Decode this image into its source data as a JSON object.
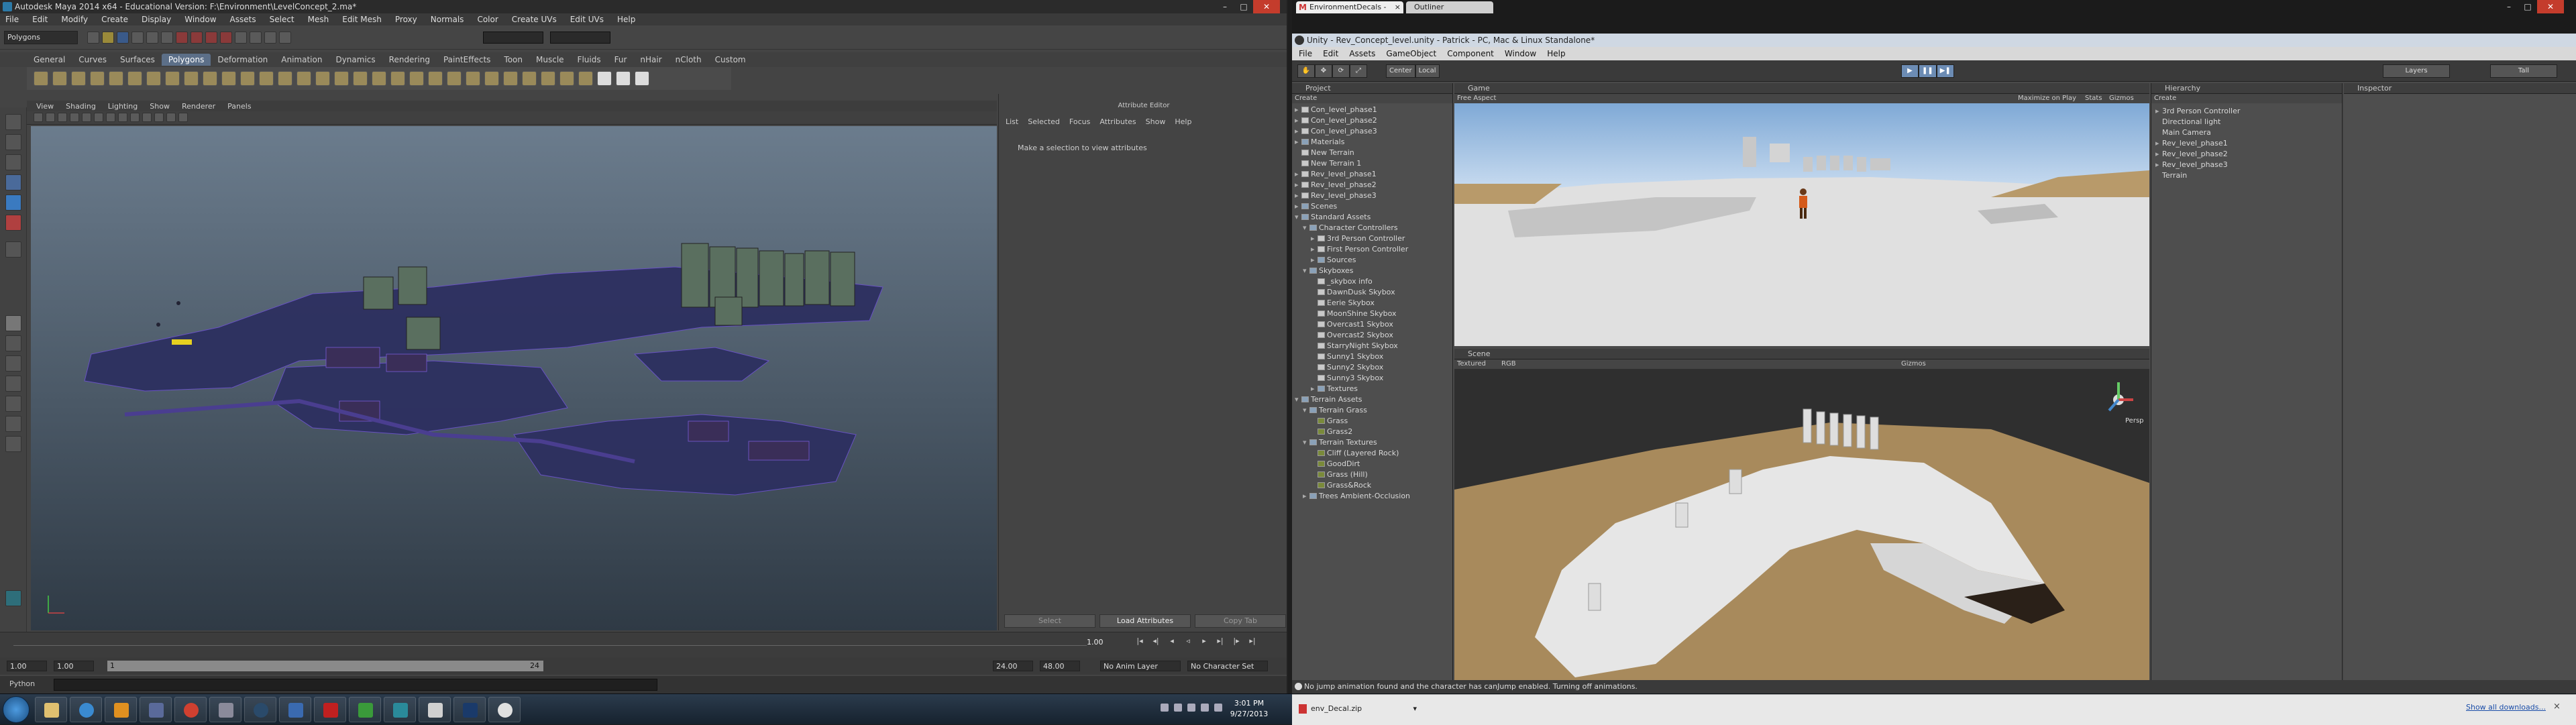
{
  "maya": {
    "title": "Autodesk Maya 2014 x64 - Educational Version: F:\\Environment\\LevelConcept_2.ma*",
    "menus": [
      "File",
      "Edit",
      "Modify",
      "Create",
      "Display",
      "Window",
      "Assets",
      "Select",
      "Mesh",
      "Edit Mesh",
      "Proxy",
      "Normals",
      "Color",
      "Create UVs",
      "Edit UVs",
      "Help"
    ],
    "mode": "Polygons",
    "shelf_tabs": [
      "General",
      "Curves",
      "Surfaces",
      "Polygons",
      "Deformation",
      "Animation",
      "Dynamics",
      "Rendering",
      "PaintEffects",
      "Toon",
      "Muscle",
      "Fluids",
      "Fur",
      "nHair",
      "nCloth",
      "Custom"
    ],
    "active_shelf_tab": "Polygons",
    "panel_menus": [
      "View",
      "Shading",
      "Lighting",
      "Show",
      "Renderer",
      "Panels"
    ],
    "attribute_editor": {
      "header": "Attribute Editor",
      "menus": [
        "List",
        "Selected",
        "Focus",
        "Attributes",
        "Show",
        "Help"
      ],
      "message": "Make a selection to view attributes",
      "buttons": [
        "Select",
        "Load Attributes",
        "Copy Tab"
      ]
    },
    "time": {
      "current_frame": "1.00",
      "start": "1.00",
      "start2": "1.00",
      "range_start": "1",
      "range_end": "24",
      "end": "24.00",
      "end2": "48.00",
      "anim_layer": "No Anim Layer",
      "char_set": "No Character Set"
    },
    "cmd_label": "Python"
  },
  "browser": {
    "tab_title": "EnvironmentDecals - pat...",
    "tab2": "Outliner",
    "download_file": "env_Decal.zip",
    "show_all": "Show all downloads...",
    "close": "×"
  },
  "unity": {
    "title": "Unity - Rev_Concept_level.unity - Patrick - PC, Mac & Linux Standalone*",
    "menus": [
      "File",
      "Edit",
      "Assets",
      "GameObject",
      "Component",
      "Window",
      "Help"
    ],
    "toolbar": {
      "pivot": "Center",
      "space": "Local",
      "layers": "Layers",
      "layout": "Tall"
    },
    "project": {
      "tab": "Project",
      "create": "Create",
      "items": [
        {
          "label": "Con_level_phase1",
          "depth": 0,
          "kind": "file",
          "arrow": "▸"
        },
        {
          "label": "Con_level_phase2",
          "depth": 0,
          "kind": "file",
          "arrow": "▸"
        },
        {
          "label": "Con_level_phase3",
          "depth": 0,
          "kind": "file",
          "arrow": "▸"
        },
        {
          "label": "Materials",
          "depth": 0,
          "kind": "folder",
          "arrow": "▸"
        },
        {
          "label": "New Terrain",
          "depth": 0,
          "kind": "file",
          "arrow": ""
        },
        {
          "label": "New Terrain 1",
          "depth": 0,
          "kind": "file",
          "arrow": ""
        },
        {
          "label": "Rev_level_phase1",
          "depth": 0,
          "kind": "file",
          "arrow": "▸"
        },
        {
          "label": "Rev_level_phase2",
          "depth": 0,
          "kind": "file",
          "arrow": "▸"
        },
        {
          "label": "Rev_level_phase3",
          "depth": 0,
          "kind": "file",
          "arrow": "▸"
        },
        {
          "label": "Scenes",
          "depth": 0,
          "kind": "folder",
          "arrow": "▸"
        },
        {
          "label": "Standard Assets",
          "depth": 0,
          "kind": "folder",
          "arrow": "▾"
        },
        {
          "label": "Character Controllers",
          "depth": 1,
          "kind": "folder",
          "arrow": "▾"
        },
        {
          "label": "3rd Person Controller",
          "depth": 2,
          "kind": "file",
          "arrow": "▸"
        },
        {
          "label": "First Person Controller",
          "depth": 2,
          "kind": "file",
          "arrow": "▸"
        },
        {
          "label": "Sources",
          "depth": 2,
          "kind": "folder",
          "arrow": "▸"
        },
        {
          "label": "Skyboxes",
          "depth": 1,
          "kind": "folder",
          "arrow": "▾"
        },
        {
          "label": "_skybox info",
          "depth": 2,
          "kind": "file",
          "arrow": ""
        },
        {
          "label": "DawnDusk Skybox",
          "depth": 2,
          "kind": "file",
          "arrow": ""
        },
        {
          "label": "Eerie Skybox",
          "depth": 2,
          "kind": "file",
          "arrow": ""
        },
        {
          "label": "MoonShine Skybox",
          "depth": 2,
          "kind": "file",
          "arrow": ""
        },
        {
          "label": "Overcast1 Skybox",
          "depth": 2,
          "kind": "file",
          "arrow": ""
        },
        {
          "label": "Overcast2 Skybox",
          "depth": 2,
          "kind": "file",
          "arrow": ""
        },
        {
          "label": "StarryNight Skybox",
          "depth": 2,
          "kind": "file",
          "arrow": ""
        },
        {
          "label": "Sunny1 Skybox",
          "depth": 2,
          "kind": "file",
          "arrow": ""
        },
        {
          "label": "Sunny2 Skybox",
          "depth": 2,
          "kind": "file",
          "arrow": ""
        },
        {
          "label": "Sunny3 Skybox",
          "depth": 2,
          "kind": "file",
          "arrow": ""
        },
        {
          "label": "Textures",
          "depth": 2,
          "kind": "folder",
          "arrow": "▸"
        },
        {
          "label": "Terrain Assets",
          "depth": 0,
          "kind": "folder",
          "arrow": "▾"
        },
        {
          "label": "Terrain Grass",
          "depth": 1,
          "kind": "folder",
          "arrow": "▾"
        },
        {
          "label": "Grass",
          "depth": 2,
          "kind": "tex",
          "arrow": ""
        },
        {
          "label": "Grass2",
          "depth": 2,
          "kind": "tex",
          "arrow": ""
        },
        {
          "label": "Terrain Textures",
          "depth": 1,
          "kind": "folder",
          "arrow": "▾"
        },
        {
          "label": "Cliff (Layered Rock)",
          "depth": 2,
          "kind": "tex",
          "arrow": ""
        },
        {
          "label": "GoodDirt",
          "depth": 2,
          "kind": "tex",
          "arrow": ""
        },
        {
          "label": "Grass (Hill)",
          "depth": 2,
          "kind": "tex",
          "arrow": ""
        },
        {
          "label": "Grass&Rock",
          "depth": 2,
          "kind": "tex",
          "arrow": ""
        },
        {
          "label": "Trees Ambient-Occlusion",
          "depth": 1,
          "kind": "folder",
          "arrow": "▸"
        }
      ]
    },
    "game": {
      "tab": "Game",
      "aspect": "Free Aspect",
      "maximize": "Maximize on Play",
      "stats": "Stats",
      "gizmos": "Gizmos"
    },
    "scene": {
      "tab": "Scene",
      "shading": "Textured",
      "mode": "RGB",
      "gizmos": "Gizmos",
      "persp": "Persp"
    },
    "hierarchy": {
      "tab": "Hierarchy",
      "create": "Create",
      "items": [
        {
          "label": "3rd Person Controller",
          "arrow": "▸"
        },
        {
          "label": "Directional light",
          "arrow": ""
        },
        {
          "label": "Main Camera",
          "arrow": ""
        },
        {
          "label": "Rev_level_phase1",
          "arrow": "▸"
        },
        {
          "label": "Rev_level_phase2",
          "arrow": "▸"
        },
        {
          "label": "Rev_level_phase3",
          "arrow": "▸"
        },
        {
          "label": "Terrain",
          "arrow": ""
        }
      ]
    },
    "inspector": {
      "tab": "Inspector"
    },
    "status": "No jump animation found and the character has canJump enabled. Turning off animations."
  },
  "taskbar": {
    "time": "3:01 PM",
    "date": "9/27/2013"
  }
}
